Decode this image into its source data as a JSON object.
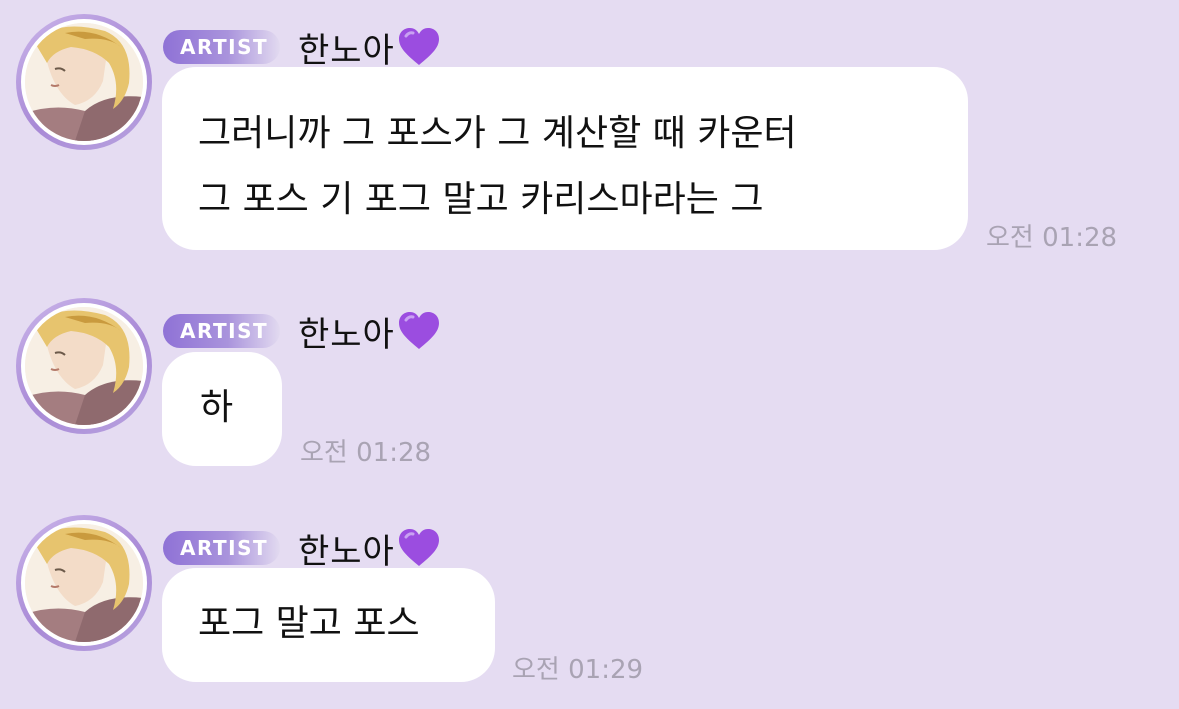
{
  "messages": [
    {
      "badge": "ARTIST",
      "name": "한노아",
      "name_emoji": "purple-heart-icon",
      "lines": [
        "그러니까 그 포스가 그 계산할 때 카운터",
        "그 포스 기 포그 말고 카리스마라는 그"
      ],
      "time": "오전 01:28"
    },
    {
      "badge": "ARTIST",
      "name": "한노아",
      "name_emoji": "purple-heart-icon",
      "lines": [
        "하"
      ],
      "time": "오전 01:28"
    },
    {
      "badge": "ARTIST",
      "name": "한노아",
      "name_emoji": "purple-heart-icon",
      "lines": [
        "포그 말고 포스"
      ],
      "time": "오전 01:29"
    }
  ],
  "colors": {
    "background": "#e5dcf2",
    "bubble": "#ffffff",
    "badge_start": "#8f72d6",
    "heart": "#9b4de0",
    "timestamp": "#a9a3b3"
  }
}
